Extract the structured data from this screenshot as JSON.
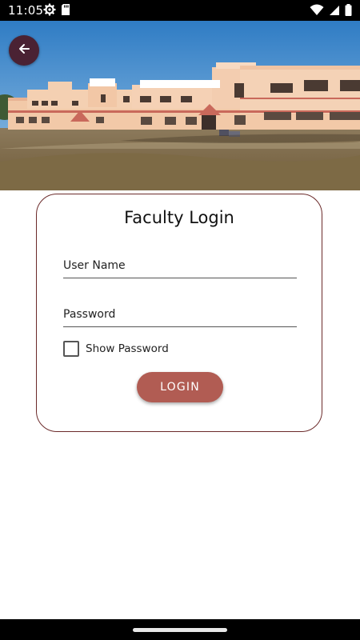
{
  "status_bar": {
    "time": "11:05",
    "left_icons": [
      "settings-gear-icon",
      "sd-card-icon"
    ],
    "right_icons": [
      "wifi-icon",
      "signal-icon",
      "battery-icon"
    ]
  },
  "header": {
    "back_icon": "arrow-left-icon",
    "colors": {
      "back_button": "#4a2233"
    }
  },
  "login_card": {
    "title": "Faculty Login",
    "username": {
      "placeholder": "User Name",
      "value": ""
    },
    "password": {
      "placeholder": "Password",
      "value": ""
    },
    "show_password": {
      "label": "Show Password",
      "checked": false
    },
    "login_button": {
      "label": "LOGIN"
    },
    "colors": {
      "border": "#6b2a2a",
      "button": "#b15c53"
    }
  }
}
